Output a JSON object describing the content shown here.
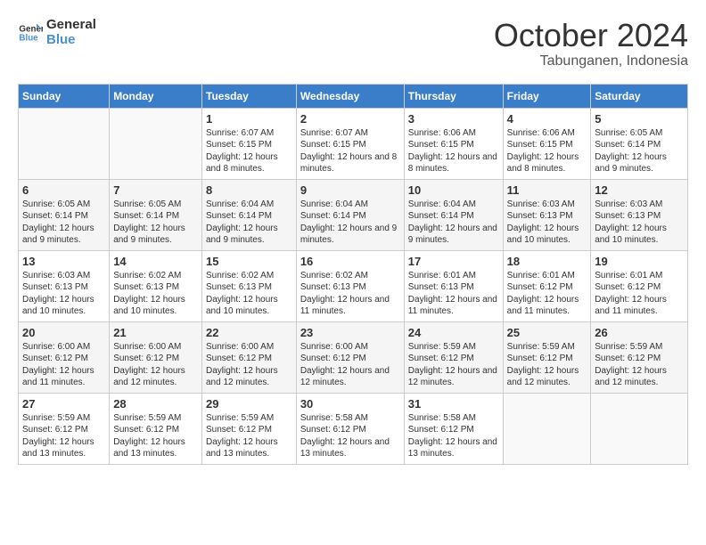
{
  "logo": {
    "line1": "General",
    "line2": "Blue"
  },
  "header": {
    "month": "October 2024",
    "location": "Tabunganen, Indonesia"
  },
  "columns": [
    "Sunday",
    "Monday",
    "Tuesday",
    "Wednesday",
    "Thursday",
    "Friday",
    "Saturday"
  ],
  "weeks": [
    [
      {
        "day": "",
        "info": ""
      },
      {
        "day": "",
        "info": ""
      },
      {
        "day": "1",
        "info": "Sunrise: 6:07 AM\nSunset: 6:15 PM\nDaylight: 12 hours and 8 minutes."
      },
      {
        "day": "2",
        "info": "Sunrise: 6:07 AM\nSunset: 6:15 PM\nDaylight: 12 hours and 8 minutes."
      },
      {
        "day": "3",
        "info": "Sunrise: 6:06 AM\nSunset: 6:15 PM\nDaylight: 12 hours and 8 minutes."
      },
      {
        "day": "4",
        "info": "Sunrise: 6:06 AM\nSunset: 6:15 PM\nDaylight: 12 hours and 8 minutes."
      },
      {
        "day": "5",
        "info": "Sunrise: 6:05 AM\nSunset: 6:14 PM\nDaylight: 12 hours and 9 minutes."
      }
    ],
    [
      {
        "day": "6",
        "info": "Sunrise: 6:05 AM\nSunset: 6:14 PM\nDaylight: 12 hours and 9 minutes."
      },
      {
        "day": "7",
        "info": "Sunrise: 6:05 AM\nSunset: 6:14 PM\nDaylight: 12 hours and 9 minutes."
      },
      {
        "day": "8",
        "info": "Sunrise: 6:04 AM\nSunset: 6:14 PM\nDaylight: 12 hours and 9 minutes."
      },
      {
        "day": "9",
        "info": "Sunrise: 6:04 AM\nSunset: 6:14 PM\nDaylight: 12 hours and 9 minutes."
      },
      {
        "day": "10",
        "info": "Sunrise: 6:04 AM\nSunset: 6:14 PM\nDaylight: 12 hours and 9 minutes."
      },
      {
        "day": "11",
        "info": "Sunrise: 6:03 AM\nSunset: 6:13 PM\nDaylight: 12 hours and 10 minutes."
      },
      {
        "day": "12",
        "info": "Sunrise: 6:03 AM\nSunset: 6:13 PM\nDaylight: 12 hours and 10 minutes."
      }
    ],
    [
      {
        "day": "13",
        "info": "Sunrise: 6:03 AM\nSunset: 6:13 PM\nDaylight: 12 hours and 10 minutes."
      },
      {
        "day": "14",
        "info": "Sunrise: 6:02 AM\nSunset: 6:13 PM\nDaylight: 12 hours and 10 minutes."
      },
      {
        "day": "15",
        "info": "Sunrise: 6:02 AM\nSunset: 6:13 PM\nDaylight: 12 hours and 10 minutes."
      },
      {
        "day": "16",
        "info": "Sunrise: 6:02 AM\nSunset: 6:13 PM\nDaylight: 12 hours and 11 minutes."
      },
      {
        "day": "17",
        "info": "Sunrise: 6:01 AM\nSunset: 6:13 PM\nDaylight: 12 hours and 11 minutes."
      },
      {
        "day": "18",
        "info": "Sunrise: 6:01 AM\nSunset: 6:12 PM\nDaylight: 12 hours and 11 minutes."
      },
      {
        "day": "19",
        "info": "Sunrise: 6:01 AM\nSunset: 6:12 PM\nDaylight: 12 hours and 11 minutes."
      }
    ],
    [
      {
        "day": "20",
        "info": "Sunrise: 6:00 AM\nSunset: 6:12 PM\nDaylight: 12 hours and 11 minutes."
      },
      {
        "day": "21",
        "info": "Sunrise: 6:00 AM\nSunset: 6:12 PM\nDaylight: 12 hours and 12 minutes."
      },
      {
        "day": "22",
        "info": "Sunrise: 6:00 AM\nSunset: 6:12 PM\nDaylight: 12 hours and 12 minutes."
      },
      {
        "day": "23",
        "info": "Sunrise: 6:00 AM\nSunset: 6:12 PM\nDaylight: 12 hours and 12 minutes."
      },
      {
        "day": "24",
        "info": "Sunrise: 5:59 AM\nSunset: 6:12 PM\nDaylight: 12 hours and 12 minutes."
      },
      {
        "day": "25",
        "info": "Sunrise: 5:59 AM\nSunset: 6:12 PM\nDaylight: 12 hours and 12 minutes."
      },
      {
        "day": "26",
        "info": "Sunrise: 5:59 AM\nSunset: 6:12 PM\nDaylight: 12 hours and 12 minutes."
      }
    ],
    [
      {
        "day": "27",
        "info": "Sunrise: 5:59 AM\nSunset: 6:12 PM\nDaylight: 12 hours and 13 minutes."
      },
      {
        "day": "28",
        "info": "Sunrise: 5:59 AM\nSunset: 6:12 PM\nDaylight: 12 hours and 13 minutes."
      },
      {
        "day": "29",
        "info": "Sunrise: 5:59 AM\nSunset: 6:12 PM\nDaylight: 12 hours and 13 minutes."
      },
      {
        "day": "30",
        "info": "Sunrise: 5:58 AM\nSunset: 6:12 PM\nDaylight: 12 hours and 13 minutes."
      },
      {
        "day": "31",
        "info": "Sunrise: 5:58 AM\nSunset: 6:12 PM\nDaylight: 12 hours and 13 minutes."
      },
      {
        "day": "",
        "info": ""
      },
      {
        "day": "",
        "info": ""
      }
    ]
  ]
}
